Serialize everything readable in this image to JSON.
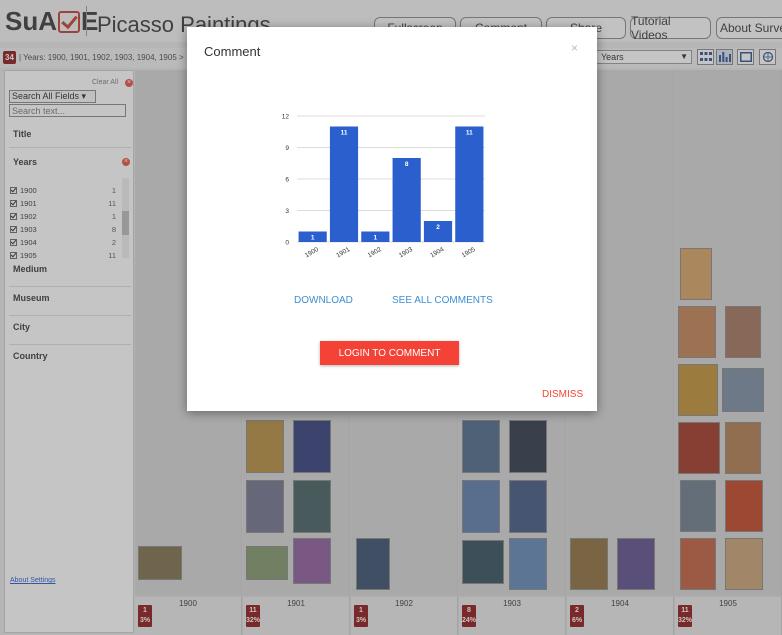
{
  "header": {
    "logo_text_left": "SuA",
    "logo_text_right": "E",
    "title": "Picasso Paintings",
    "buttons": [
      "Fullscreen",
      "Comment",
      "Share",
      "Tutorial Videos",
      "About Survey"
    ]
  },
  "breadcrumb": {
    "count": "34",
    "text": "| Years: 1900, 1901, 1902, 1903, 1904, 1905 >"
  },
  "toolbar": {
    "sort_value": "Years",
    "view_icons": [
      "grid-view-icon",
      "bar-view-icon",
      "table-view-icon",
      "map-view-icon"
    ]
  },
  "sidebar": {
    "clear_all": "Clear All",
    "search_field_select": "Search All Fields",
    "search_placeholder": "Search text...",
    "facets": {
      "title": "Title",
      "years": "Years",
      "medium": "Medium",
      "museum": "Museum",
      "city": "City",
      "country": "Country"
    },
    "year_items": [
      {
        "label": "1900",
        "count": "1"
      },
      {
        "label": "1901",
        "count": "11"
      },
      {
        "label": "1902",
        "count": "1"
      },
      {
        "label": "1903",
        "count": "8"
      },
      {
        "label": "1904",
        "count": "2"
      },
      {
        "label": "1905",
        "count": "11"
      }
    ],
    "footer_about": "About",
    "footer_settings": "Settings"
  },
  "bins": [
    {
      "label": "1900",
      "count": "1",
      "percent": "3%"
    },
    {
      "label": "1901",
      "count": "11",
      "percent": "32%"
    },
    {
      "label": "1902",
      "count": "1",
      "percent": "3%"
    },
    {
      "label": "1903",
      "count": "8",
      "percent": "24%"
    },
    {
      "label": "1904",
      "count": "2",
      "percent": "6%"
    },
    {
      "label": "1905",
      "count": "11",
      "percent": "32%"
    }
  ],
  "modal": {
    "title": "Comment",
    "close": "×",
    "download": "DOWNLOAD",
    "see_all": "SEE ALL COMMENTS",
    "login": "LOGIN TO COMMENT",
    "dismiss": "DISMISS"
  },
  "chart_data": {
    "type": "bar",
    "categories": [
      "1900",
      "1901",
      "1902",
      "1903",
      "1904",
      "1905"
    ],
    "values": [
      1,
      11,
      1,
      8,
      2,
      11
    ],
    "ylim": [
      0,
      12
    ],
    "yticks": [
      0,
      3,
      6,
      9,
      12
    ],
    "grid": true,
    "color": "#2b5fce"
  },
  "colors": {
    "accent_red": "#f44336",
    "badge": "#8b1010",
    "link_blue": "#3d8fd1",
    "bar_blue": "#2b5fce"
  }
}
